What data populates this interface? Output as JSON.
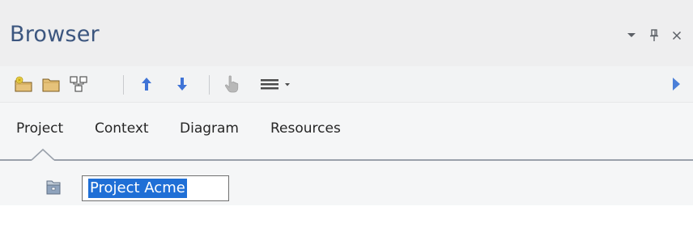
{
  "window": {
    "title": "Browser",
    "controls": {
      "dropdown_icon": "chevron-down-icon",
      "pin_icon": "pin-icon",
      "close_icon": "close-icon"
    }
  },
  "toolbar": {
    "buttons": [
      {
        "icon": "new-root-node-icon"
      },
      {
        "icon": "new-package-icon"
      },
      {
        "icon": "new-diagram-icon"
      },
      {
        "icon": "move-up-icon"
      },
      {
        "icon": "move-down-icon"
      },
      {
        "icon": "locate-icon"
      },
      {
        "icon": "menu-icon"
      },
      {
        "icon": "scroll-right-icon"
      }
    ],
    "colors": {
      "arrow": "#3f73d6",
      "folder": "#e6c27a",
      "disabled": "#b8b8b8",
      "scroll_arrow": "#4b7fd8"
    }
  },
  "tabs": [
    {
      "label": "Project"
    },
    {
      "label": "Context"
    },
    {
      "label": "Diagram"
    },
    {
      "label": "Resources"
    }
  ],
  "tree": {
    "node": {
      "icon": "model-root-icon",
      "edit_value": "Project Acme"
    }
  },
  "colors": {
    "title": "#3c567f",
    "selection": "#1f6fd6"
  }
}
